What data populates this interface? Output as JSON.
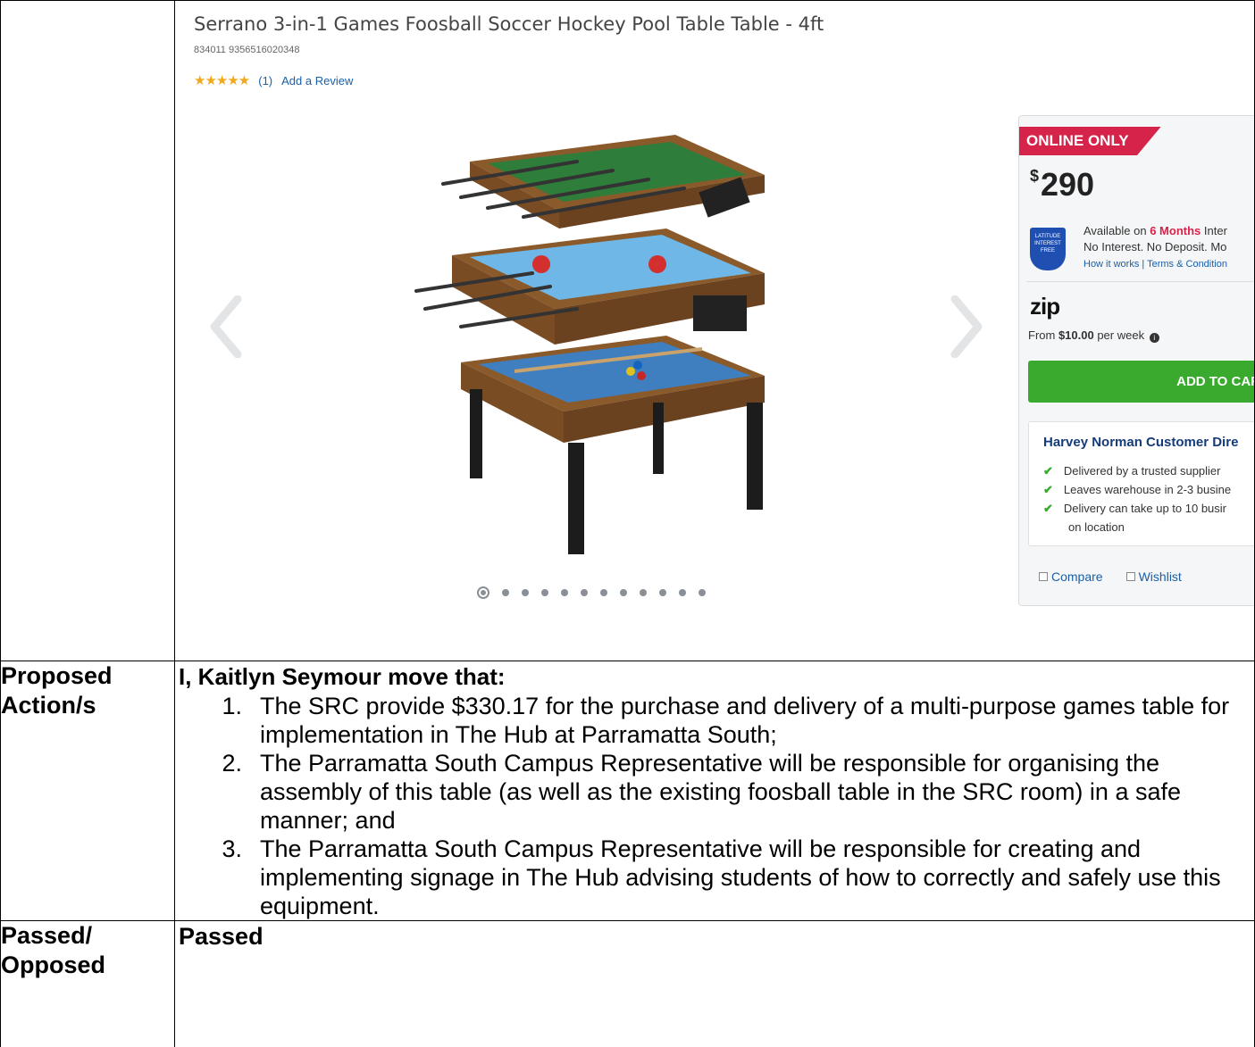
{
  "screenshot": {
    "title": "Serrano 3-in-1 Games Foosball Soccer Hockey Pool Table Table - 4ft",
    "sku": "834011 9356516020348",
    "stars": "★★★★★",
    "review_count": "(1)",
    "add_review": "Add a Review",
    "panel": {
      "badge": "ONLINE ONLY",
      "currency": "$",
      "price": "290",
      "latitude_logo": "LATITUDE INTEREST FREE",
      "latitude_line1_prefix": "Available on ",
      "latitude_line1_highlight": "6 Months",
      "latitude_line1_suffix": " Inter",
      "latitude_line2": "No Interest. No Deposit. Mo",
      "latitude_links": "How it works | Terms & Condition",
      "zip_logo": "zip",
      "zip_prefix": "From ",
      "zip_amount": "$10.00",
      "zip_suffix": " per week",
      "add_to_cart": "ADD TO CAR",
      "delivery_title": "Harvey Norman Customer Dire",
      "delivery_items": [
        "Delivered by a trusted supplier",
        "Leaves warehouse in 2-3 busine",
        "Delivery can take up to 10 busir"
      ],
      "delivery_extra": "on location",
      "compare": "Compare",
      "wishlist": "Wishlist"
    },
    "carousel_dots": 12,
    "active_dot": 0
  },
  "rows": {
    "action_label": "Proposed Action/s",
    "motion_head": "I, Kaitlyn Seymour move that:",
    "motion_items": [
      "The SRC provide $330.17 for the purchase and delivery of a multi-purpose games table for implementation in The Hub at Parramatta South;",
      "The Parramatta South Campus Representative will be responsible for organising the assembly of this table (as well as the existing foosball table in the SRC room) in a safe manner; and",
      "The Parramatta South Campus Representative will be responsible for creating and implementing signage in The Hub advising students of how to correctly and safely use this equipment."
    ],
    "motion_numbers": [
      "1.",
      "2.",
      "3."
    ],
    "passed_label": "Passed/ Opposed",
    "passed_value": "Passed"
  },
  "colors": {
    "badge": "#d6234a",
    "cart_button": "#3aaa2e",
    "link": "#1a5fa8",
    "star": "#f3a81b"
  }
}
